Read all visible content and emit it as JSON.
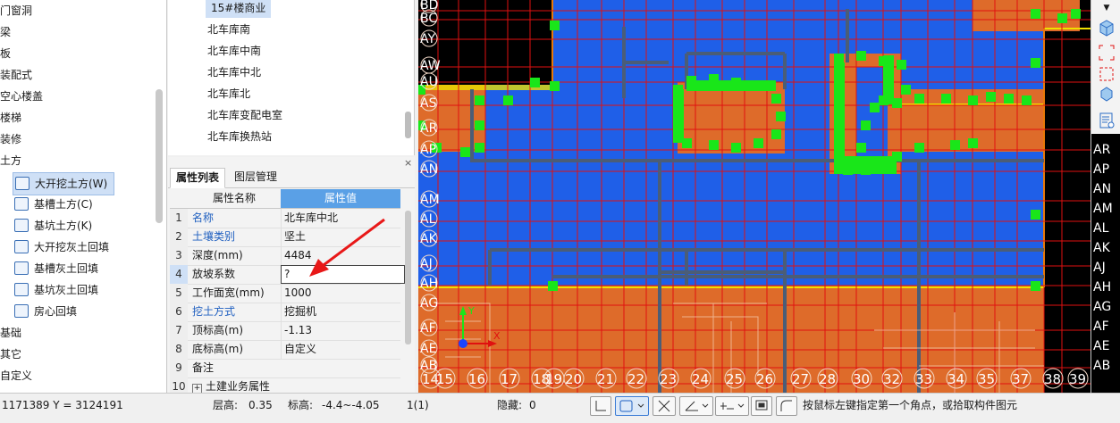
{
  "tree": {
    "items": [
      {
        "label": "门窗洞"
      },
      {
        "label": "梁"
      },
      {
        "label": "板"
      },
      {
        "label": "装配式"
      },
      {
        "label": "空心楼盖"
      },
      {
        "label": "楼梯"
      },
      {
        "label": "装修"
      },
      {
        "label": "土方"
      },
      {
        "label": "大开挖土方(W)",
        "selected": true,
        "icon": "excavation-icon"
      },
      {
        "label": "基槽土方(C)",
        "icon": "trench-icon"
      },
      {
        "label": "基坑土方(K)",
        "icon": "pit-icon"
      },
      {
        "label": "大开挖灰土回填",
        "icon": "excavation-backfill-icon"
      },
      {
        "label": "基槽灰土回填",
        "icon": "trench-backfill-icon"
      },
      {
        "label": "基坑灰土回填",
        "icon": "pit-backfill-icon"
      },
      {
        "label": "房心回填",
        "icon": "room-backfill-icon"
      },
      {
        "label": "基础"
      },
      {
        "label": "其它"
      },
      {
        "label": "自定义"
      }
    ]
  },
  "components": {
    "items": [
      "15#楼商业",
      "北车库南",
      "北车库中南",
      "北车库中北",
      "北车库北",
      "北车库变配电室",
      "北车库换热站"
    ],
    "selected_index": 0
  },
  "properties": {
    "tabs": [
      "属性列表",
      "图层管理"
    ],
    "close": "×",
    "header": {
      "name": "属性名称",
      "value": "属性值"
    },
    "rows": [
      {
        "n": "1",
        "name": "名称",
        "value": "北车库中北",
        "link": true
      },
      {
        "n": "2",
        "name": "土壤类别",
        "value": "坚土",
        "link": true
      },
      {
        "n": "3",
        "name": "深度(mm)",
        "value": "4484",
        "link": false
      },
      {
        "n": "4",
        "name": "放坡系数",
        "value": "?",
        "link": false,
        "active": true
      },
      {
        "n": "5",
        "name": "工作面宽(mm)",
        "value": "1000",
        "link": false
      },
      {
        "n": "6",
        "name": "挖土方式",
        "value": "挖掘机",
        "link": true
      },
      {
        "n": "7",
        "name": "顶标高(m)",
        "value": "-1.13",
        "link": false
      },
      {
        "n": "8",
        "name": "底标高(m)",
        "value": "自定义",
        "link": false
      },
      {
        "n": "9",
        "name": "备注",
        "value": "",
        "link": false
      },
      {
        "n": "10",
        "name": "土建业务属性",
        "value": "",
        "link": false,
        "expand": "+"
      }
    ]
  },
  "cad": {
    "left_axis": [
      "BD",
      "BC",
      "AY",
      "AW",
      "AU",
      "AS",
      "AR",
      "AP",
      "AN",
      "AM",
      "AL",
      "AK",
      "AJ",
      "AH",
      "AG",
      "AF",
      "AE",
      "AB"
    ],
    "bottom_axis": [
      "14",
      "15",
      "16",
      "17",
      "18",
      "19",
      "20",
      "21",
      "22",
      "23",
      "24",
      "25",
      "26",
      "27",
      "28",
      "30",
      "32",
      "33",
      "34",
      "35",
      "37",
      "38",
      "39"
    ],
    "right_axis": [
      "AR",
      "AP",
      "AN",
      "AM",
      "AL",
      "AK",
      "AJ",
      "AH",
      "AG",
      "AF",
      "AE",
      "AB"
    ],
    "ucs": {
      "x": "X",
      "y": "Y"
    },
    "colors": {
      "blue_fill": "#1f5fe8",
      "orange_fill": "#de6b2a",
      "grid_red": "#e01010",
      "green_grip": "#19e619",
      "yellow_border": "#f0e000",
      "wall_gray": "#4b5d77"
    }
  },
  "status": {
    "coords": "1171389 Y = 3124191",
    "floor_height_label": "层高:",
    "floor_height": "0.35",
    "elevation_label": "标高:",
    "elevation": "-4.4~-4.05",
    "selection": "1(1)",
    "hidden_label": "隐藏:",
    "hidden": "0",
    "prompt": "按鼠标左键指定第一个角点，或拾取构件图元"
  }
}
